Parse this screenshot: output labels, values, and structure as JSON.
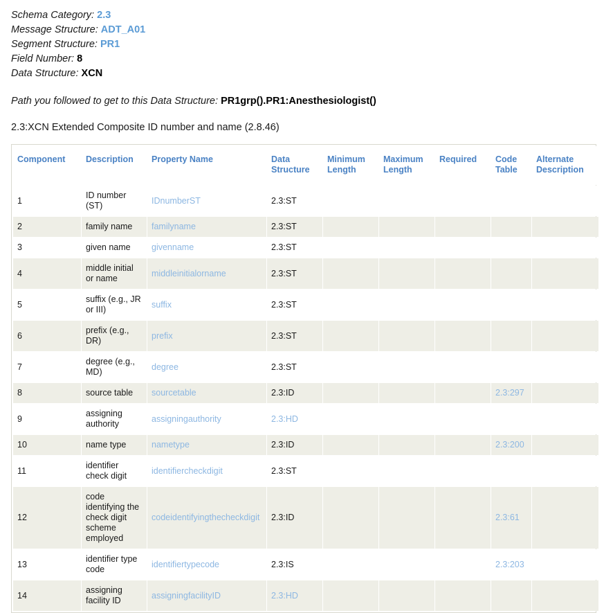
{
  "meta": {
    "lines": [
      {
        "label": "Schema Category:",
        "value": "2.3",
        "style": "link"
      },
      {
        "label": "Message Structure:",
        "value": "ADT_A01",
        "style": "link"
      },
      {
        "label": "Segment Structure:",
        "value": "PR1",
        "style": "link"
      },
      {
        "label": "Field Number:",
        "value": "8",
        "style": "bold"
      },
      {
        "label": "Data Structure:",
        "value": "XCN",
        "style": "bold"
      }
    ]
  },
  "path": {
    "label": "Path you followed to get to this Data Structure:",
    "value": "PR1grp().PR1:Anesthesiologist()"
  },
  "structure_caption": "2.3:XCN Extended Composite ID number and name (2.8.46)",
  "table": {
    "columns": [
      "Component",
      "Description",
      "Property Name",
      "Data Structure",
      "Minimum Length",
      "Maximum Length",
      "Required",
      "Code Table",
      "Alternate Description"
    ],
    "rows": [
      {
        "component": "1",
        "description": "ID number (ST)",
        "property_name": "IDnumberST",
        "data_structure": "2.3:ST",
        "data_structure_link": false,
        "minimum_length": "",
        "maximum_length": "",
        "required": "",
        "code_table": "",
        "alternate_description": ""
      },
      {
        "component": "2",
        "description": "family name",
        "property_name": "familyname",
        "data_structure": "2.3:ST",
        "data_structure_link": false,
        "minimum_length": "",
        "maximum_length": "",
        "required": "",
        "code_table": "",
        "alternate_description": ""
      },
      {
        "component": "3",
        "description": "given name",
        "property_name": "givenname",
        "data_structure": "2.3:ST",
        "data_structure_link": false,
        "minimum_length": "",
        "maximum_length": "",
        "required": "",
        "code_table": "",
        "alternate_description": ""
      },
      {
        "component": "4",
        "description": "middle initial or name",
        "property_name": "middleinitialorname",
        "data_structure": "2.3:ST",
        "data_structure_link": false,
        "minimum_length": "",
        "maximum_length": "",
        "required": "",
        "code_table": "",
        "alternate_description": ""
      },
      {
        "component": "5",
        "description": "suffix (e.g., JR or III)",
        "property_name": "suffix",
        "data_structure": "2.3:ST",
        "data_structure_link": false,
        "minimum_length": "",
        "maximum_length": "",
        "required": "",
        "code_table": "",
        "alternate_description": ""
      },
      {
        "component": "6",
        "description": "prefix (e.g., DR)",
        "property_name": "prefix",
        "data_structure": "2.3:ST",
        "data_structure_link": false,
        "minimum_length": "",
        "maximum_length": "",
        "required": "",
        "code_table": "",
        "alternate_description": ""
      },
      {
        "component": "7",
        "description": "degree (e.g., MD)",
        "property_name": "degree",
        "data_structure": "2.3:ST",
        "data_structure_link": false,
        "minimum_length": "",
        "maximum_length": "",
        "required": "",
        "code_table": "",
        "alternate_description": ""
      },
      {
        "component": "8",
        "description": "source table",
        "property_name": "sourcetable",
        "data_structure": "2.3:ID",
        "data_structure_link": false,
        "minimum_length": "",
        "maximum_length": "",
        "required": "",
        "code_table": "2.3:297",
        "alternate_description": ""
      },
      {
        "component": "9",
        "description": "assigning authority",
        "property_name": "assigningauthority",
        "data_structure": "2.3:HD",
        "data_structure_link": true,
        "minimum_length": "",
        "maximum_length": "",
        "required": "",
        "code_table": "",
        "alternate_description": ""
      },
      {
        "component": "10",
        "description": "name type",
        "property_name": "nametype",
        "data_structure": "2.3:ID",
        "data_structure_link": false,
        "minimum_length": "",
        "maximum_length": "",
        "required": "",
        "code_table": "2.3:200",
        "alternate_description": ""
      },
      {
        "component": "11",
        "description": "identifier check digit",
        "property_name": "identifiercheckdigit",
        "data_structure": "2.3:ST",
        "data_structure_link": false,
        "minimum_length": "",
        "maximum_length": "",
        "required": "",
        "code_table": "",
        "alternate_description": ""
      },
      {
        "component": "12",
        "description": "code identifying the check digit scheme employed",
        "property_name": "codeidentifyingthecheckdigit",
        "data_structure": "2.3:ID",
        "data_structure_link": false,
        "minimum_length": "",
        "maximum_length": "",
        "required": "",
        "code_table": "2.3:61",
        "alternate_description": ""
      },
      {
        "component": "13",
        "description": "identifier type code",
        "property_name": "identifiertypecode",
        "data_structure": "2.3:IS",
        "data_structure_link": false,
        "minimum_length": "",
        "maximum_length": "",
        "required": "",
        "code_table": "2.3:203",
        "alternate_description": ""
      },
      {
        "component": "14",
        "description": "assigning facility ID",
        "property_name": "assigningfacilityID",
        "data_structure": "2.3:HD",
        "data_structure_link": true,
        "minimum_length": "",
        "maximum_length": "",
        "required": "",
        "code_table": "",
        "alternate_description": ""
      }
    ]
  },
  "colors": {
    "header_link": "#5B9BD5",
    "table_header": "#4A82C4",
    "cell_link": "#8DB7E2",
    "row_even_bg": "#eeeee6",
    "table_border": "#d9d9cf"
  }
}
